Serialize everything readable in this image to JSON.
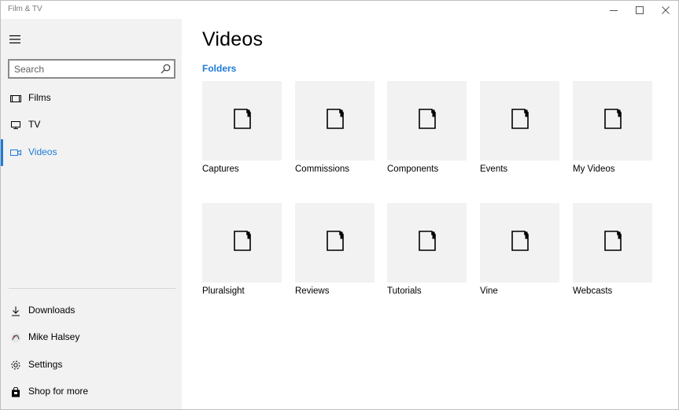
{
  "window": {
    "title": "Film & TV"
  },
  "sidebar": {
    "search": {
      "placeholder": "Search",
      "value": ""
    },
    "nav_top": [
      {
        "label": "Films",
        "icon": "film-icon"
      },
      {
        "label": "TV",
        "icon": "tv-icon"
      },
      {
        "label": "Videos",
        "icon": "video-camera-icon",
        "active": true
      }
    ],
    "nav_bottom": [
      {
        "label": "Downloads",
        "icon": "download-icon"
      },
      {
        "label": "Mike Halsey",
        "icon": "avatar"
      },
      {
        "label": "Settings",
        "icon": "gear-icon"
      },
      {
        "label": "Shop for more",
        "icon": "shopping-bag-icon"
      }
    ]
  },
  "main": {
    "title": "Videos",
    "section": "Folders",
    "folders": [
      {
        "label": "Captures"
      },
      {
        "label": "Commissions"
      },
      {
        "label": "Components"
      },
      {
        "label": "Events"
      },
      {
        "label": "My Videos"
      },
      {
        "label": "Pluralsight"
      },
      {
        "label": "Reviews"
      },
      {
        "label": "Tutorials"
      },
      {
        "label": "Vine"
      },
      {
        "label": "Webcasts"
      }
    ]
  },
  "colors": {
    "accent": "#1e7bd6",
    "sidebar_bg": "#f2f2f2",
    "tile_bg": "#f2f2f2"
  }
}
